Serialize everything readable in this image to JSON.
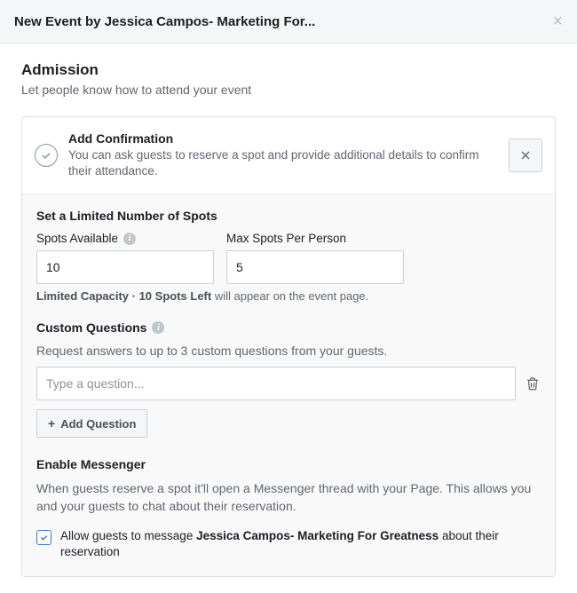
{
  "header": {
    "title": "New Event by Jessica Campos- Marketing For..."
  },
  "section": {
    "heading": "Admission",
    "sub": "Let people know how to attend your event"
  },
  "confirm": {
    "title": "Add Confirmation",
    "desc": "You can ask guests to reserve a spot and provide additional details to confirm their attendance."
  },
  "spots": {
    "heading": "Set a Limited Number of Spots",
    "available_label": "Spots Available",
    "max_label": "Max Spots Per Person",
    "available_value": "10",
    "max_value": "5",
    "helper_bold": "Limited Capacity · 10 Spots Left",
    "helper_rest": " will appear on the event page."
  },
  "custom_q": {
    "heading": "Custom Questions",
    "desc": "Request answers to up to 3 custom questions from your guests.",
    "placeholder": "Type a question...",
    "add_label": "Add Question"
  },
  "messenger": {
    "heading": "Enable Messenger",
    "desc": "When guests reserve a spot it'll open a Messenger thread with your Page. This allows you and your guests to chat about their reservation.",
    "allow_pre": "Allow guests to message ",
    "allow_bold": "Jessica Campos- Marketing For Greatness",
    "allow_post": " about their reservation",
    "checked": true
  }
}
